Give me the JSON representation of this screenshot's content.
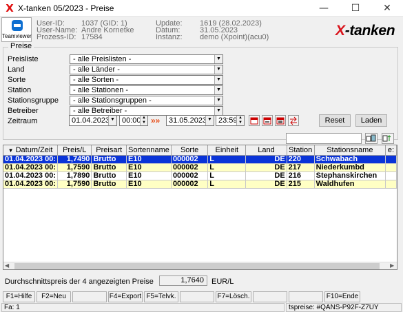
{
  "window": {
    "title": "X-tanken 05/2023 - Preise",
    "app_icon": "X",
    "minimize": "—",
    "maximize": "☐",
    "close": "✕"
  },
  "teamviewer": {
    "label": "Teamviewer"
  },
  "header": {
    "user_id_label": "User-ID:",
    "user_id": "1037 (GID: 1)",
    "user_name_label": "User-Name:",
    "user_name": "Andre Kornetke",
    "prozess_id_label": "Prozess-ID:",
    "prozess_id": "17584",
    "update_label": "Update:",
    "update": "1619 (28.02.2023)",
    "datum_label": "Datum:",
    "datum": "31.05.2023",
    "instanz_label": "Instanz:",
    "instanz": "demo (Xpoint)(acu0)",
    "brand_x": "X",
    "brand_rest": "-tanken"
  },
  "filters": {
    "group_title": "Preise",
    "rows": [
      {
        "label": "Preisliste",
        "value": "- alle Preislisten -"
      },
      {
        "label": "Land",
        "value": "- alle Länder -"
      },
      {
        "label": "Sorte",
        "value": "- alle Sorten -"
      },
      {
        "label": "Station",
        "value": "- alle Stationen -"
      },
      {
        "label": "Stationsgruppe",
        "value": "- alle Stationsgruppen -"
      },
      {
        "label": "Betreiber",
        "value": "- alle Betreiber -"
      }
    ],
    "zeitraum_label": "Zeitraum",
    "date_from": "01.04.2023",
    "time_from": "00:00",
    "date_to": "31.05.2023",
    "time_to": "23:59",
    "reset_label": "Reset",
    "laden_label": "Laden"
  },
  "search": {
    "value": ""
  },
  "table": {
    "columns": [
      "Datum/Zeit",
      "Preis/L",
      "Preisart",
      "Sortenname",
      "Sorte",
      "Einheit",
      "Land",
      "Station",
      "Stationsname",
      "e:"
    ],
    "rows": [
      [
        "01.04.2023 00:",
        "1,7490",
        "Brutto",
        "E10",
        "000002",
        "L",
        "DE",
        "220",
        "Schwabach",
        ""
      ],
      [
        "01.04.2023 00:",
        "1,7590",
        "Brutto",
        "E10",
        "000002",
        "L",
        "DE",
        "217",
        "Niederkumbd",
        ""
      ],
      [
        "01.04.2023 00:",
        "1,7890",
        "Brutto",
        "E10",
        "000002",
        "L",
        "DE",
        "216",
        "Stephanskirchen",
        ""
      ],
      [
        "01.04.2023 00:",
        "1,7590",
        "Brutto",
        "E10",
        "000002",
        "L",
        "DE",
        "215",
        "Waldhufen",
        ""
      ]
    ]
  },
  "summary": {
    "label": "Durchschnittspreis der 4 angezeigten Preise",
    "value": "1,7640",
    "unit": "EUR/L"
  },
  "fkeys": [
    "F1=Hilfe",
    "F2=Neu",
    "",
    "F4=Export",
    "F5=Telvk.",
    "",
    "F7=Lösch.",
    "",
    "",
    "F10=Ende"
  ],
  "status": {
    "left": "Fa: 1",
    "right": "tspreise: #QANS-P92F-Z7UY"
  },
  "colors": {
    "selected_row": "#0a34d8",
    "alt_row": "#ffffc4",
    "brand_red": "#d9141c"
  }
}
